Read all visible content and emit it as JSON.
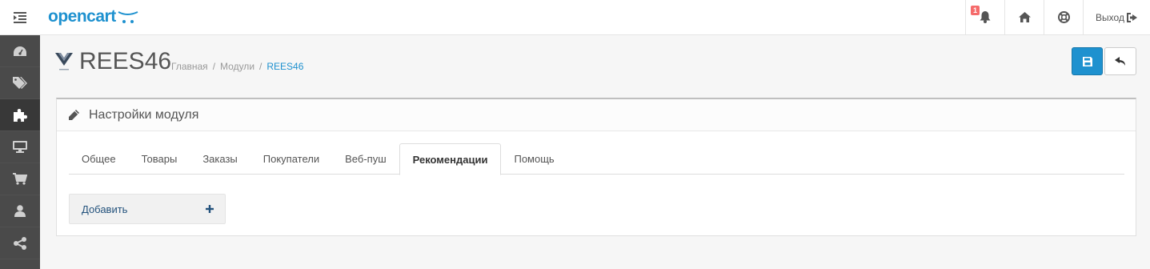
{
  "header": {
    "logo": "opencart",
    "notifications_count": "1",
    "logout_label": "Выход",
    "icons": [
      "menu-icon",
      "bell-icon",
      "home-icon",
      "lifebuoy-icon",
      "sign-out-icon"
    ]
  },
  "sidebar": {
    "items": [
      {
        "icon": "dashboard-icon"
      },
      {
        "icon": "tags-icon"
      },
      {
        "icon": "puzzle-icon",
        "active": true
      },
      {
        "icon": "desktop-icon"
      },
      {
        "icon": "shopping-cart-icon"
      },
      {
        "icon": "user-icon"
      },
      {
        "icon": "share-icon"
      }
    ]
  },
  "page": {
    "title": "REES46",
    "breadcrumb": [
      "Главная",
      "Модули",
      "REES46"
    ]
  },
  "panel": {
    "title": "Настройки модуля",
    "tabs": [
      "Общее",
      "Товары",
      "Заказы",
      "Покупатели",
      "Веб-пуш",
      "Рекомендации",
      "Помощь"
    ],
    "active_tab": "Рекомендации",
    "add_label": "Добавить"
  },
  "colors": {
    "primary": "#1e91cf",
    "sidebar": "#4a4a4a",
    "badge": "#f56b6b"
  }
}
